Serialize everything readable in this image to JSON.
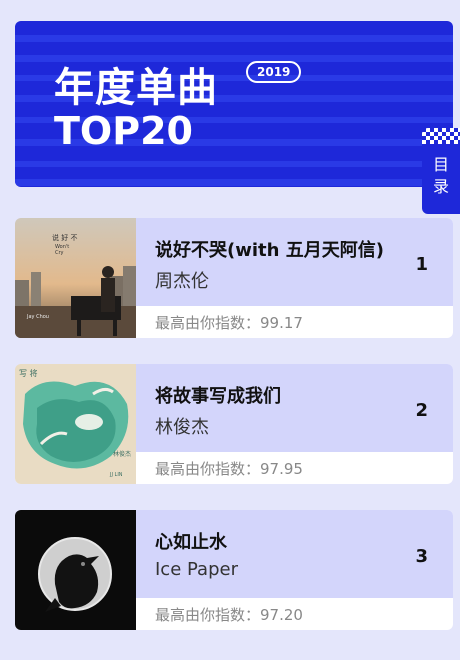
{
  "banner": {
    "title": "年度单曲",
    "subtitle": "TOP20",
    "year": "2019",
    "accent": "#1e28d9"
  },
  "toc": {
    "label": "目\n录"
  },
  "score_prefix": "最高由你指数：",
  "songs": [
    {
      "title": "说好不哭(with 五月天阿信)",
      "artist": "周杰伦",
      "rank": "1",
      "score_text": "最高由你指数：99.17",
      "cover_text": "说好不哭 Won't Cry 周杰伦 Jay Chou"
    },
    {
      "title": "将故事写成我们",
      "artist": "林俊杰",
      "rank": "2",
      "score_text": "最高由你指数：97.95",
      "cover_text": "将故事写成我们 林俊杰 JJ LIN"
    },
    {
      "title": "心如止水",
      "artist": "Ice Paper",
      "rank": "3",
      "score_text": "最高由你指数：97.20",
      "cover_text": ""
    }
  ]
}
